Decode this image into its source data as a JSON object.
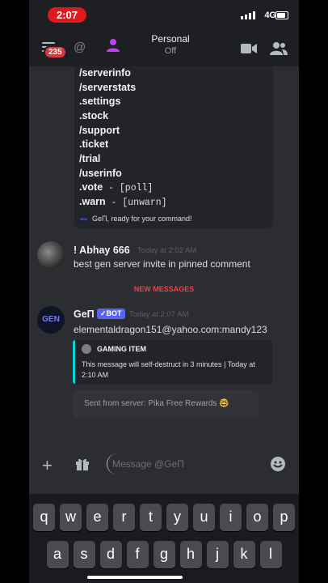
{
  "status": {
    "time": "2:07",
    "network": "4G"
  },
  "header": {
    "badge": "235",
    "title": "Personal",
    "subtitle": "Off"
  },
  "commands": [
    {
      "cmd": "/serverinfo",
      "sub": ""
    },
    {
      "cmd": "/serverstats",
      "sub": ""
    },
    {
      "cmd": ".settings",
      "sub": ""
    },
    {
      "cmd": ".stock",
      "sub": ""
    },
    {
      "cmd": "/support",
      "sub": ""
    },
    {
      "cmd": ".ticket",
      "sub": ""
    },
    {
      "cmd": "/trial",
      "sub": ""
    },
    {
      "cmd": "/userinfo",
      "sub": ""
    },
    {
      "cmd": ".vote",
      "sub": " - [poll]"
    },
    {
      "cmd": ".warn",
      "sub": " - [unwarn]"
    }
  ],
  "cmd_footer": "GeΠ, ready for your command!",
  "message1": {
    "name": "! Abhay 666",
    "time": "Today at 2:02 AM",
    "text": "best gen server invite in pinned comment"
  },
  "new_messages": "NEW MESSAGES",
  "message2": {
    "name": "GeΠ",
    "bot_tag": "✓BOT",
    "time": "Today at 2:07 AM",
    "text": "elementaldragon151@yahoo.com:mandy123",
    "avatar_label": "GEN",
    "embed_title": "GAMING ITEM",
    "embed_desc": "This message will self-destruct in 3 minutes | Today at 2:10 AM",
    "sent_from": "Sent from server: Pika Free Rewards 🤓"
  },
  "composer": {
    "placeholder": "Message @GeΠ"
  },
  "keyboard": {
    "row1": [
      "q",
      "w",
      "e",
      "r",
      "t",
      "y",
      "u",
      "i",
      "o",
      "p"
    ],
    "row2": [
      "a",
      "s",
      "d",
      "f",
      "g",
      "h",
      "j",
      "k",
      "l"
    ]
  },
  "colors": {
    "accent": "#5865f2",
    "danger": "#f23f43",
    "embed_border": "#0fd3d3"
  }
}
